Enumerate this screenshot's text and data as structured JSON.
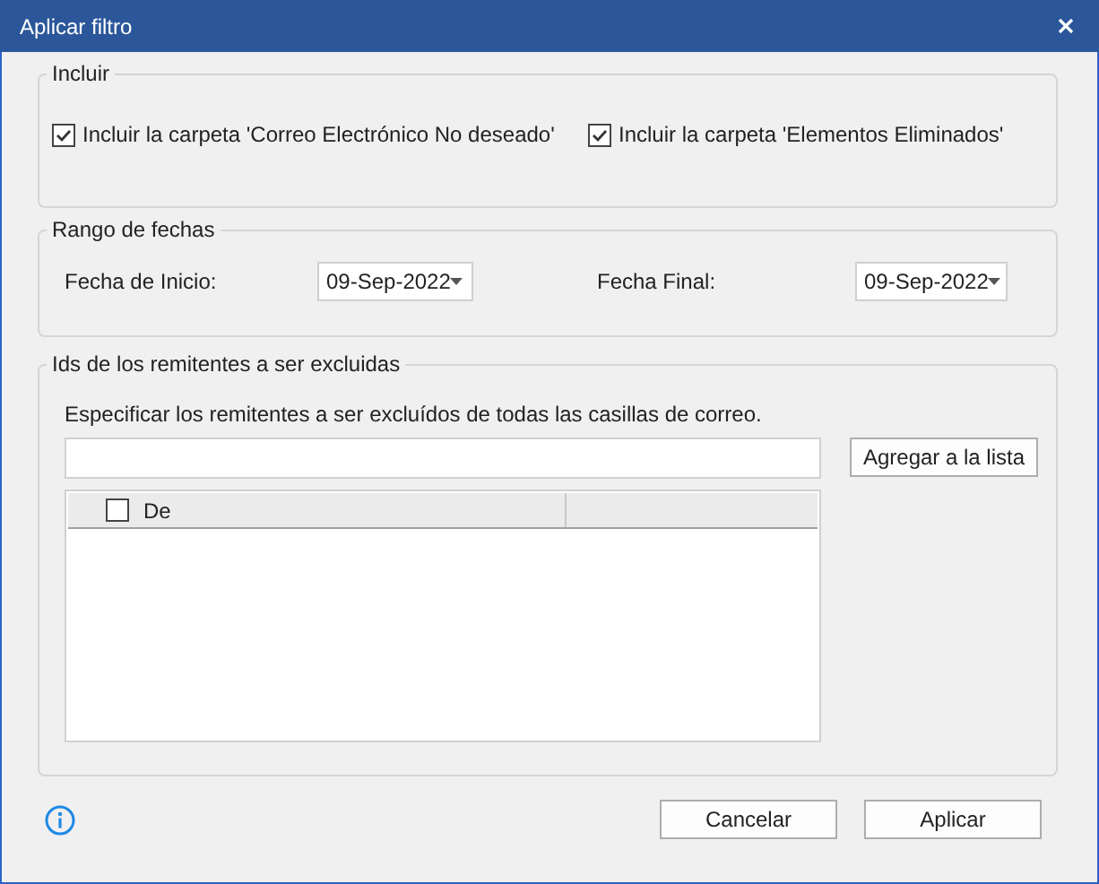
{
  "window": {
    "title": "Aplicar filtro"
  },
  "include": {
    "title": "Incluir",
    "options": [
      {
        "label": "Incluir la carpeta 'Correo Electrónico No deseado'",
        "checked": true
      },
      {
        "label": "Incluir la carpeta 'Elementos Eliminados'",
        "checked": true
      }
    ]
  },
  "date_range": {
    "title": "Rango de fechas",
    "fields": [
      {
        "label": "Fecha de Inicio:",
        "value": "09-Sep-2022"
      },
      {
        "label": "Fecha Final:",
        "value": "09-Sep-2022"
      }
    ]
  },
  "excluded_senders": {
    "title": "Ids de los remitentes a ser excluidas",
    "instruction": "Especificar los remitentes a ser excluídos de todas las casillas de correo.",
    "add_button": "Agregar a la lista",
    "list": {
      "columns": [
        {
          "label": "De",
          "checked": false
        }
      ]
    }
  },
  "buttons": [
    "Cancelar",
    "Aplicar"
  ]
}
